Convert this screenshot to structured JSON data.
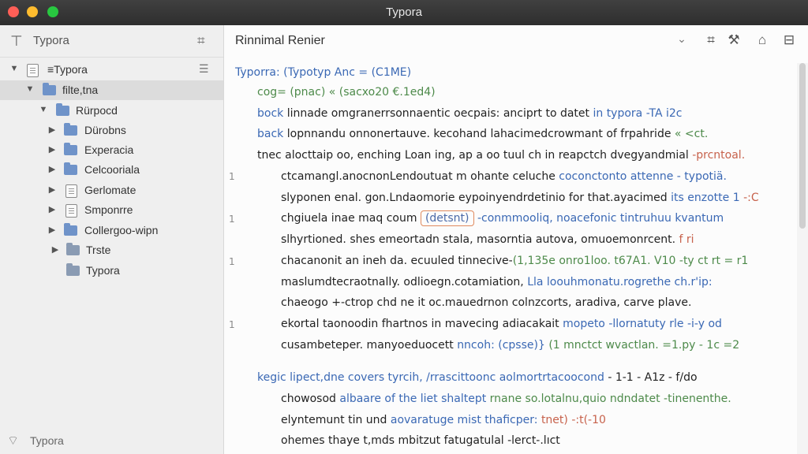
{
  "window": {
    "title": "Typora"
  },
  "sidebar": {
    "header_title": "Typora",
    "tree": [
      {
        "label": "≡Typora",
        "type": "doc"
      },
      {
        "label": "filte,tna",
        "type": "folder"
      },
      {
        "label": "Rürpocd",
        "type": "folder"
      },
      {
        "label": "Dürobns",
        "type": "folder"
      },
      {
        "label": "Experacia",
        "type": "folder"
      },
      {
        "label": "Celcooriala",
        "type": "folder"
      },
      {
        "label": "Gerlomate",
        "type": "doc"
      },
      {
        "label": "Smponrre",
        "type": "doc"
      },
      {
        "label": "Collergoo-wipn",
        "type": "folder"
      },
      {
        "label": "Trste",
        "type": "folder"
      },
      {
        "label": "Typora",
        "type": "folder"
      }
    ],
    "footer_label": "Typora"
  },
  "editor": {
    "doc_title": "Rinnimal Renier",
    "lines": [
      "Typorra: (Typotyp  Anc = (C1ME)",
      "cog= (pnac)  « (sacxo20  €.1ed4)",
      "bock",
      "linnade omgranerrsonnaentic oecpais: anciprt to datet",
      "in typora -TA  i2c",
      "back",
      "lopnnandu onnonertauve. kecohand lahacimedcrowmant of frpahride",
      "« <ct.",
      "tnec  alocttaip oo, enching Loan ing, ap a oo tuul ch in reapctch dvegyandmial",
      "-prcntoal.",
      "ctcamangl.anocnonLendoutuat m ohante celuche",
      "coconctonto  attenne - typotiä.",
      "slyponen enal. gon.Lndaomorie eypoinyendrdetinio for that.ayacimed",
      "its enzotte  1",
      "-:C",
      "chgiuela inae maq coum",
      "(detsnt)",
      "-conmmooliq, noacefonic",
      "tintruhuu kvantum",
      "slhyrtioned. shes emeortadn stala, masorntia autova, omuoemonrcent.",
      "f ri",
      "chacanonit an ineh da. ecuuled tinnecive-",
      "(1,135e onro1loo.  t67A1. V10  -ty  ct rt  = r1",
      "maslumdtecraotnally. odlioegn.cotamiation,",
      "Lla loouhmonatu.rogrethe ch.r'ip:",
      "chaeogo +-ctrop chd ne it oc.mauedrnon colnzcorts, aradiva, carve plave.",
      "ekortal taonoodin fhartnos in mavecing adiacakait",
      "mopeto  -llornatuty  rle -i-y  od",
      "cusambeteper. manyoeduocett",
      "nncoh: (cpsse)}",
      "(1  mnctct  wvactlan. =1.py - 1c  =2",
      "kegic",
      "lipect,dne covers tyrcih, /rrascittoonc aolmortrtacoocond",
      "- 1-1 -  A1z -  f/do",
      "chowosod",
      "albaare of the liet shaltept",
      "rnane so.lotalnu,quio ndndatet  -tinenenthe.",
      "elyntemunt tin und",
      "aovaratuge mist thaficper:",
      "tnet) -:t(-10",
      "ohemes thaye  t,mds mbitzut fatugatulal  -lerct-.lıct"
    ],
    "gutter_marks": [
      "1",
      "1",
      "1",
      "1"
    ]
  },
  "icons": [
    "sidebar-toggle-icon",
    "outline-icon",
    "sidebar-options-icon",
    "chevron-down-icon",
    "grid-icon",
    "tools-icon",
    "export-icon",
    "preview-icon",
    "wifi-icon"
  ],
  "colors": {
    "accent_blue": "#3a68b4",
    "accent_green": "#4d8a4a",
    "accent_red": "#c7624c",
    "highlight_border": "#e08a5e"
  }
}
